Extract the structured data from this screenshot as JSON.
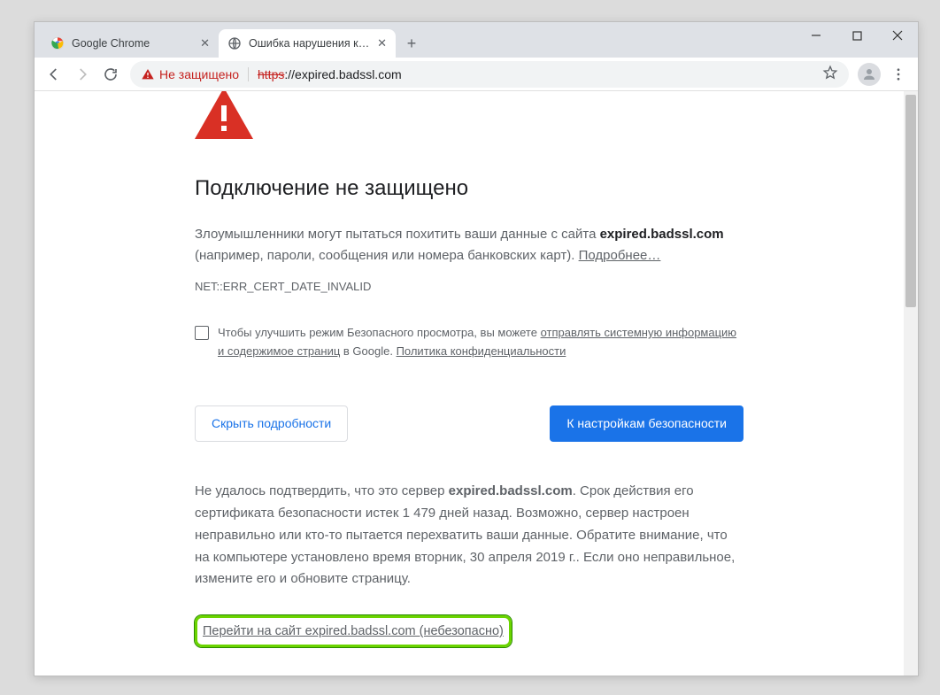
{
  "window": {
    "tabs": [
      {
        "title": "Google Chrome",
        "active": false
      },
      {
        "title": "Ошибка нарушения конфиденц",
        "active": true
      }
    ]
  },
  "toolbar": {
    "security_label": "Не защищено",
    "url_protocol": "https",
    "url_rest": "://expired.badssl.com"
  },
  "page": {
    "heading": "Подключение не защищено",
    "intro_prefix": "Злоумышленники могут пытаться похитить ваши данные с сайта ",
    "intro_domain": "expired.badssl.com",
    "intro_suffix": " (например, пароли, сообщения или номера банковских карт). ",
    "learn_more": "Подробнее…",
    "error_code": "NET::ERR_CERT_DATE_INVALID",
    "checkbox_prefix": "Чтобы улучшить режим Безопасного просмотра, вы можете ",
    "checkbox_link1": "отправлять системную информацию и содержимое страниц",
    "checkbox_mid": " в Google. ",
    "checkbox_link2": "Политика конфиденциальности",
    "hide_details": "Скрыть подробности",
    "back_to_safety": "К настройкам безопасности",
    "details_p1a": "Не удалось подтвердить, что это сервер ",
    "details_domain": "expired.badssl.com",
    "details_p1b": ". Срок действия его сертификата безопасности истек 1 479 дней назад. Возможно, сервер настроен неправильно или кто-то пытается перехватить ваши данные. Обратите внимание, что на компьютере установлено время вторник, 30 апреля 2019 г.. Если оно неправильное, измените его и обновите страницу.",
    "proceed": "Перейти на сайт expired.badssl.com (небезопасно)"
  }
}
